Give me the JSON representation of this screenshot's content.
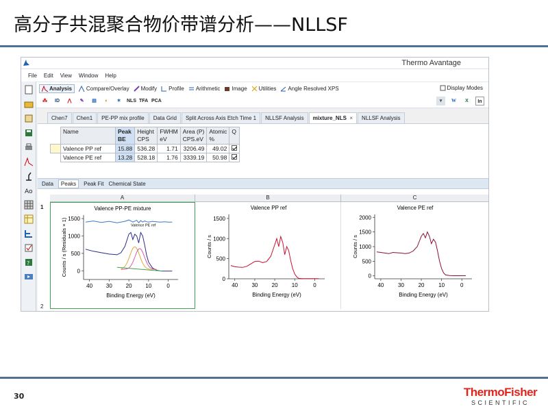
{
  "slide": {
    "title": "高分子共混聚合物价带谱分析——NLLSF",
    "page_number": "30",
    "brand_line1": "ThermoFisher",
    "brand_line2": "SCIENTIFIC"
  },
  "app": {
    "title": "Thermo Avantage",
    "menu": [
      "File",
      "Edit",
      "View",
      "Window",
      "Help"
    ],
    "ribbon_tabs": [
      "Analysis",
      "Compare/Overlay",
      "Modify",
      "Profile",
      "Arithmetic",
      "Image",
      "Utilities",
      "Angle Resolved XPS"
    ],
    "display_modes": "Display Modes",
    "toolbar_labels": {
      "id": "ID",
      "nls": "NLS",
      "tfa": "TFA",
      "pca": "PCA",
      "word": "W",
      "excel": "X",
      "in": "In"
    },
    "doc_tabs": [
      "Chen7",
      "Chen1",
      "PE-PP mix profile",
      "Data Grid",
      "Split Across Axis Etch Time 1",
      "NLLSF Analysis",
      "mixture_NLS",
      "×",
      "NLLSF Analysis"
    ],
    "active_doc_tab": "mixture_NLS"
  },
  "peak_table": {
    "headers": [
      "Name",
      "Peak\nBE",
      "Height\nCPS",
      "FWHM\neV",
      "Area (P)\nCPS.eV",
      "Atomic\n%",
      "Q"
    ],
    "rows": [
      {
        "name": "Valence PP ref",
        "be": "15.88",
        "height": "536.28",
        "fwhm": "1.71",
        "area": "3206.49",
        "atomic": "49.02",
        "checked": true
      },
      {
        "name": "Valence PE ref",
        "be": "13.28",
        "height": "528.18",
        "fwhm": "1.76",
        "area": "3339.19",
        "atomic": "50.98",
        "checked": true
      }
    ]
  },
  "sub_tabs": [
    "Data",
    "Peaks",
    "Peak Fit",
    "Chemical State"
  ],
  "active_sub_tab": "Peaks",
  "grid": {
    "columns": [
      "A",
      "B",
      "C"
    ],
    "row1": "1",
    "row2": "2"
  },
  "plots": [
    {
      "title": "Valence PP-PE mixture",
      "ylabel": "Counts / s  (Residuals × 1)",
      "xlabel": "Binding Energy (eV)",
      "yticks": [
        "1500",
        "1000",
        "500",
        "0"
      ],
      "xticks": [
        "40",
        "30",
        "20",
        "10",
        "0"
      ],
      "legend": "Valence PE ref"
    },
    {
      "title": "Valence PP ref",
      "ylabel": "Counts / s",
      "xlabel": "Binding Energy (eV)",
      "yticks": [
        "1500",
        "1000",
        "500",
        "0"
      ],
      "xticks": [
        "40",
        "30",
        "20",
        "10",
        "0"
      ]
    },
    {
      "title": "Valence PE ref",
      "ylabel": "Counts / s",
      "xlabel": "Binding Energy (eV)",
      "yticks": [
        "2000",
        "1500",
        "1000",
        "500",
        "0"
      ],
      "xticks": [
        "40",
        "30",
        "20",
        "10",
        "0"
      ]
    }
  ],
  "chart_data": [
    {
      "type": "line",
      "title": "Valence PP-PE mixture",
      "xlabel": "Binding Energy (eV)",
      "ylabel": "Counts / s  (Residuals × 1)",
      "xlim": [
        43,
        -5
      ],
      "ylim": [
        -250,
        1600
      ],
      "series": [
        {
          "name": "",
          "x": [
            42,
            38,
            34,
            30,
            28,
            26,
            24,
            22,
            20,
            19,
            18,
            17,
            16,
            15,
            14,
            13,
            12,
            11,
            10,
            8,
            6,
            4,
            2,
            0,
            -2
          ],
          "y": [
            620,
            560,
            520,
            480,
            470,
            460,
            520,
            700,
            1050,
            1100,
            900,
            1050,
            1000,
            800,
            1100,
            1000,
            750,
            450,
            250,
            80,
            20,
            -5,
            -10,
            -10,
            -10
          ]
        },
        {
          "name": "Valence PE ref",
          "x": [
            42,
            38,
            34,
            30,
            26,
            22,
            20,
            18,
            16,
            15,
            14,
            13,
            12,
            11,
            10,
            8,
            6,
            4,
            2,
            0,
            -2
          ],
          "y": [
            1400,
            1430,
            1390,
            1420,
            1380,
            1420,
            1460,
            1400,
            1450,
            1380,
            1440,
            1400,
            1430,
            1410,
            1400,
            1420,
            1410,
            1400,
            1410,
            1400,
            1400
          ]
        }
      ]
    },
    {
      "type": "line",
      "title": "Valence PP ref",
      "xlabel": "Binding Energy (eV)",
      "ylabel": "Counts / s",
      "xlim": [
        43,
        -5
      ],
      "ylim": [
        0,
        1600
      ],
      "series": [
        {
          "name": "",
          "x": [
            42,
            40,
            38,
            36,
            34,
            32,
            30,
            28,
            26,
            24,
            22,
            20,
            19,
            18,
            17,
            16,
            15,
            14,
            13,
            12,
            11,
            10,
            9,
            8,
            6,
            4,
            2,
            0,
            -2
          ],
          "y": [
            330,
            300,
            290,
            285,
            310,
            370,
            430,
            440,
            400,
            430,
            560,
            850,
            1000,
            800,
            1050,
            900,
            600,
            800,
            700,
            450,
            250,
            120,
            50,
            10,
            5,
            5,
            5,
            5,
            5
          ]
        }
      ]
    },
    {
      "type": "line",
      "title": "Valence PE ref",
      "xlabel": "Binding Energy (eV)",
      "ylabel": "Counts / s",
      "xlim": [
        43,
        -5
      ],
      "ylim": [
        -100,
        2100
      ],
      "series": [
        {
          "name": "",
          "x": [
            42,
            40,
            38,
            36,
            34,
            32,
            30,
            28,
            26,
            24,
            22,
            20,
            19,
            18,
            17,
            16,
            15,
            14,
            13,
            12,
            11,
            10,
            9,
            8,
            6,
            4,
            2,
            0,
            -2
          ],
          "y": [
            820,
            800,
            780,
            760,
            800,
            790,
            780,
            760,
            780,
            850,
            1000,
            1350,
            1450,
            1300,
            1500,
            1350,
            1100,
            1250,
            1150,
            850,
            500,
            250,
            100,
            30,
            10,
            5,
            5,
            5,
            5
          ]
        }
      ]
    }
  ]
}
